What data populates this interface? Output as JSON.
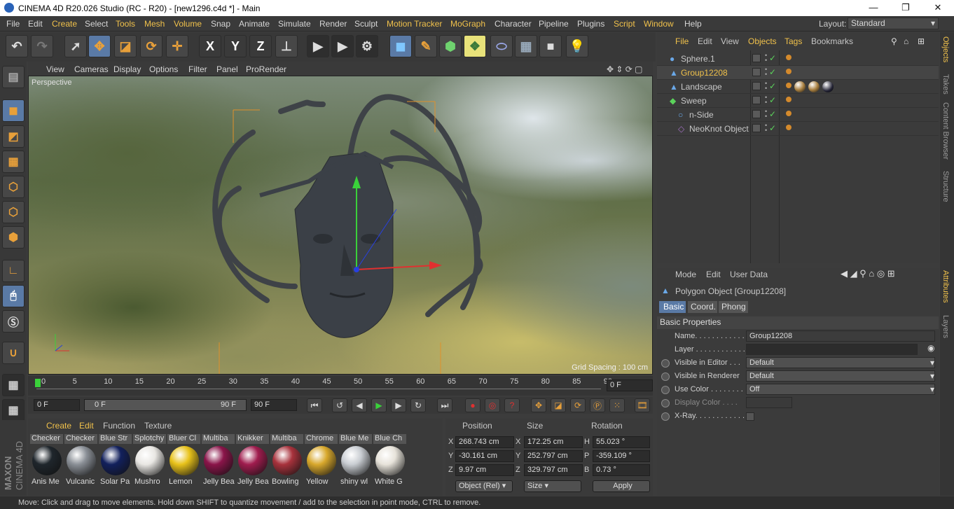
{
  "window": {
    "title": "CINEMA 4D R20.026 Studio (RC - R20) - [new1296.c4d *] - Main",
    "min": "—",
    "max": "❐",
    "close": "✕"
  },
  "menu": [
    "File",
    "Edit",
    "Create",
    "Select",
    "Tools",
    "Mesh",
    "Volume",
    "Snap",
    "Animate",
    "Simulate",
    "Render",
    "Sculpt",
    "Motion Tracker",
    "MoGraph",
    "Character",
    "Pipeline",
    "Plugins",
    "Script",
    "Window",
    "Help"
  ],
  "layout": {
    "label": "Layout:",
    "value": "Standard"
  },
  "toolbar": {
    "x_label": "X",
    "y_label": "Y",
    "z_label": "Z"
  },
  "viewport": {
    "menu": [
      "View",
      "Cameras",
      "Display",
      "Options",
      "Filter",
      "Panel",
      "ProRender"
    ],
    "camera_label": "Perspective",
    "grid_spacing": "Grid Spacing : 100 cm"
  },
  "timeline": {
    "ticks": [
      "0",
      "5",
      "10",
      "15",
      "20",
      "25",
      "30",
      "35",
      "40",
      "45",
      "50",
      "55",
      "60",
      "65",
      "70",
      "75",
      "80",
      "85",
      "90"
    ],
    "current_frame": "0 F",
    "start": "0 F",
    "range_start": "0 F",
    "range_end": "90 F",
    "end": "90 F"
  },
  "materials": {
    "menu": [
      "Create",
      "Edit",
      "Function",
      "Texture"
    ],
    "items": [
      {
        "top": "Checker",
        "bottom": "Anis Me",
        "color": "#1f262c"
      },
      {
        "top": "Checker",
        "bottom": "Vulcanic",
        "color": "#8a8f96"
      },
      {
        "top": "Blue Str",
        "bottom": "Solar Pa",
        "color": "#12205c"
      },
      {
        "top": "Splotchy",
        "bottom": "Mushro",
        "color": "#e9e7e3"
      },
      {
        "top": "Bluer Cl",
        "bottom": "Lemon",
        "color": "#e8c21a"
      },
      {
        "top": "Multiba",
        "bottom": "Jelly Bea",
        "color": "#8a1449"
      },
      {
        "top": "Knikker",
        "bottom": "Jelly Bea",
        "color": "#a01c4e"
      },
      {
        "top": "Multiba",
        "bottom": "Bowling",
        "color": "#a8323c"
      },
      {
        "top": "Chrome",
        "bottom": "Yellow",
        "color": "#d8a82c"
      },
      {
        "top": "Blue Me",
        "bottom": "shiny wl",
        "color": "#c9cdd2"
      },
      {
        "top": "Blue Ch",
        "bottom": "White G",
        "color": "#e7e3da"
      }
    ]
  },
  "coords": {
    "headers": [
      "Position",
      "Size",
      "Rotation"
    ],
    "rows": [
      {
        "axis": "X",
        "pos": "268.743 cm",
        "saxis": "X",
        "size": "172.25 cm",
        "raxis": "H",
        "rot": "55.023 °"
      },
      {
        "axis": "Y",
        "pos": "-30.161 cm",
        "saxis": "Y",
        "size": "252.797 cm",
        "raxis": "P",
        "rot": "-359.109 °"
      },
      {
        "axis": "Z",
        "pos": "9.97 cm",
        "saxis": "Z",
        "size": "329.797 cm",
        "raxis": "B",
        "rot": "0.73 °"
      }
    ],
    "mode": "Object (Rel)",
    "size_mode": "Size",
    "apply": "Apply"
  },
  "objects": {
    "menu": [
      "File",
      "Edit",
      "View",
      "Objects",
      "Tags",
      "Bookmarks"
    ],
    "items": [
      {
        "name": "Sphere.1",
        "indent": 0,
        "selected": false
      },
      {
        "name": "Group12208",
        "indent": 0,
        "selected": true
      },
      {
        "name": "Landscape",
        "indent": 0,
        "selected": false
      },
      {
        "name": "Sweep",
        "indent": 0,
        "selected": false
      },
      {
        "name": "n-Side",
        "indent": 1,
        "selected": false
      },
      {
        "name": "NeoKnot Object",
        "indent": 1,
        "selected": false
      }
    ]
  },
  "attributes": {
    "menu": [
      "Mode",
      "Edit",
      "User Data"
    ],
    "object_title": "Polygon Object [Group12208]",
    "tabs": [
      "Basic",
      "Coord.",
      "Phong"
    ],
    "section": "Basic Properties",
    "rows": [
      {
        "label": "Name. . . . . . . . . . . .",
        "value": "Group12208"
      },
      {
        "label": "Layer . . . . . . . . . . . .",
        "value": ""
      },
      {
        "label": "Visible in Editor . . .",
        "value": "Default"
      },
      {
        "label": "Visible in Renderer",
        "value": "Default"
      },
      {
        "label": "Use Color . . . . . . . .",
        "value": "Off"
      },
      {
        "label": "Display Color . . . .",
        "value": ""
      },
      {
        "label": "X-Ray. . . . . . . . . . . .",
        "value": ""
      }
    ]
  },
  "side_tabs": [
    "Objects",
    "Takes",
    "Content Browser",
    "Structure",
    "Attributes",
    "Layers"
  ],
  "status": "Move: Click and drag to move elements. Hold down SHIFT to quantize movement / add to the selection in point mode, CTRL to remove.",
  "brand": {
    "line1": "MAXON",
    "line2": "CINEMA 4D"
  }
}
